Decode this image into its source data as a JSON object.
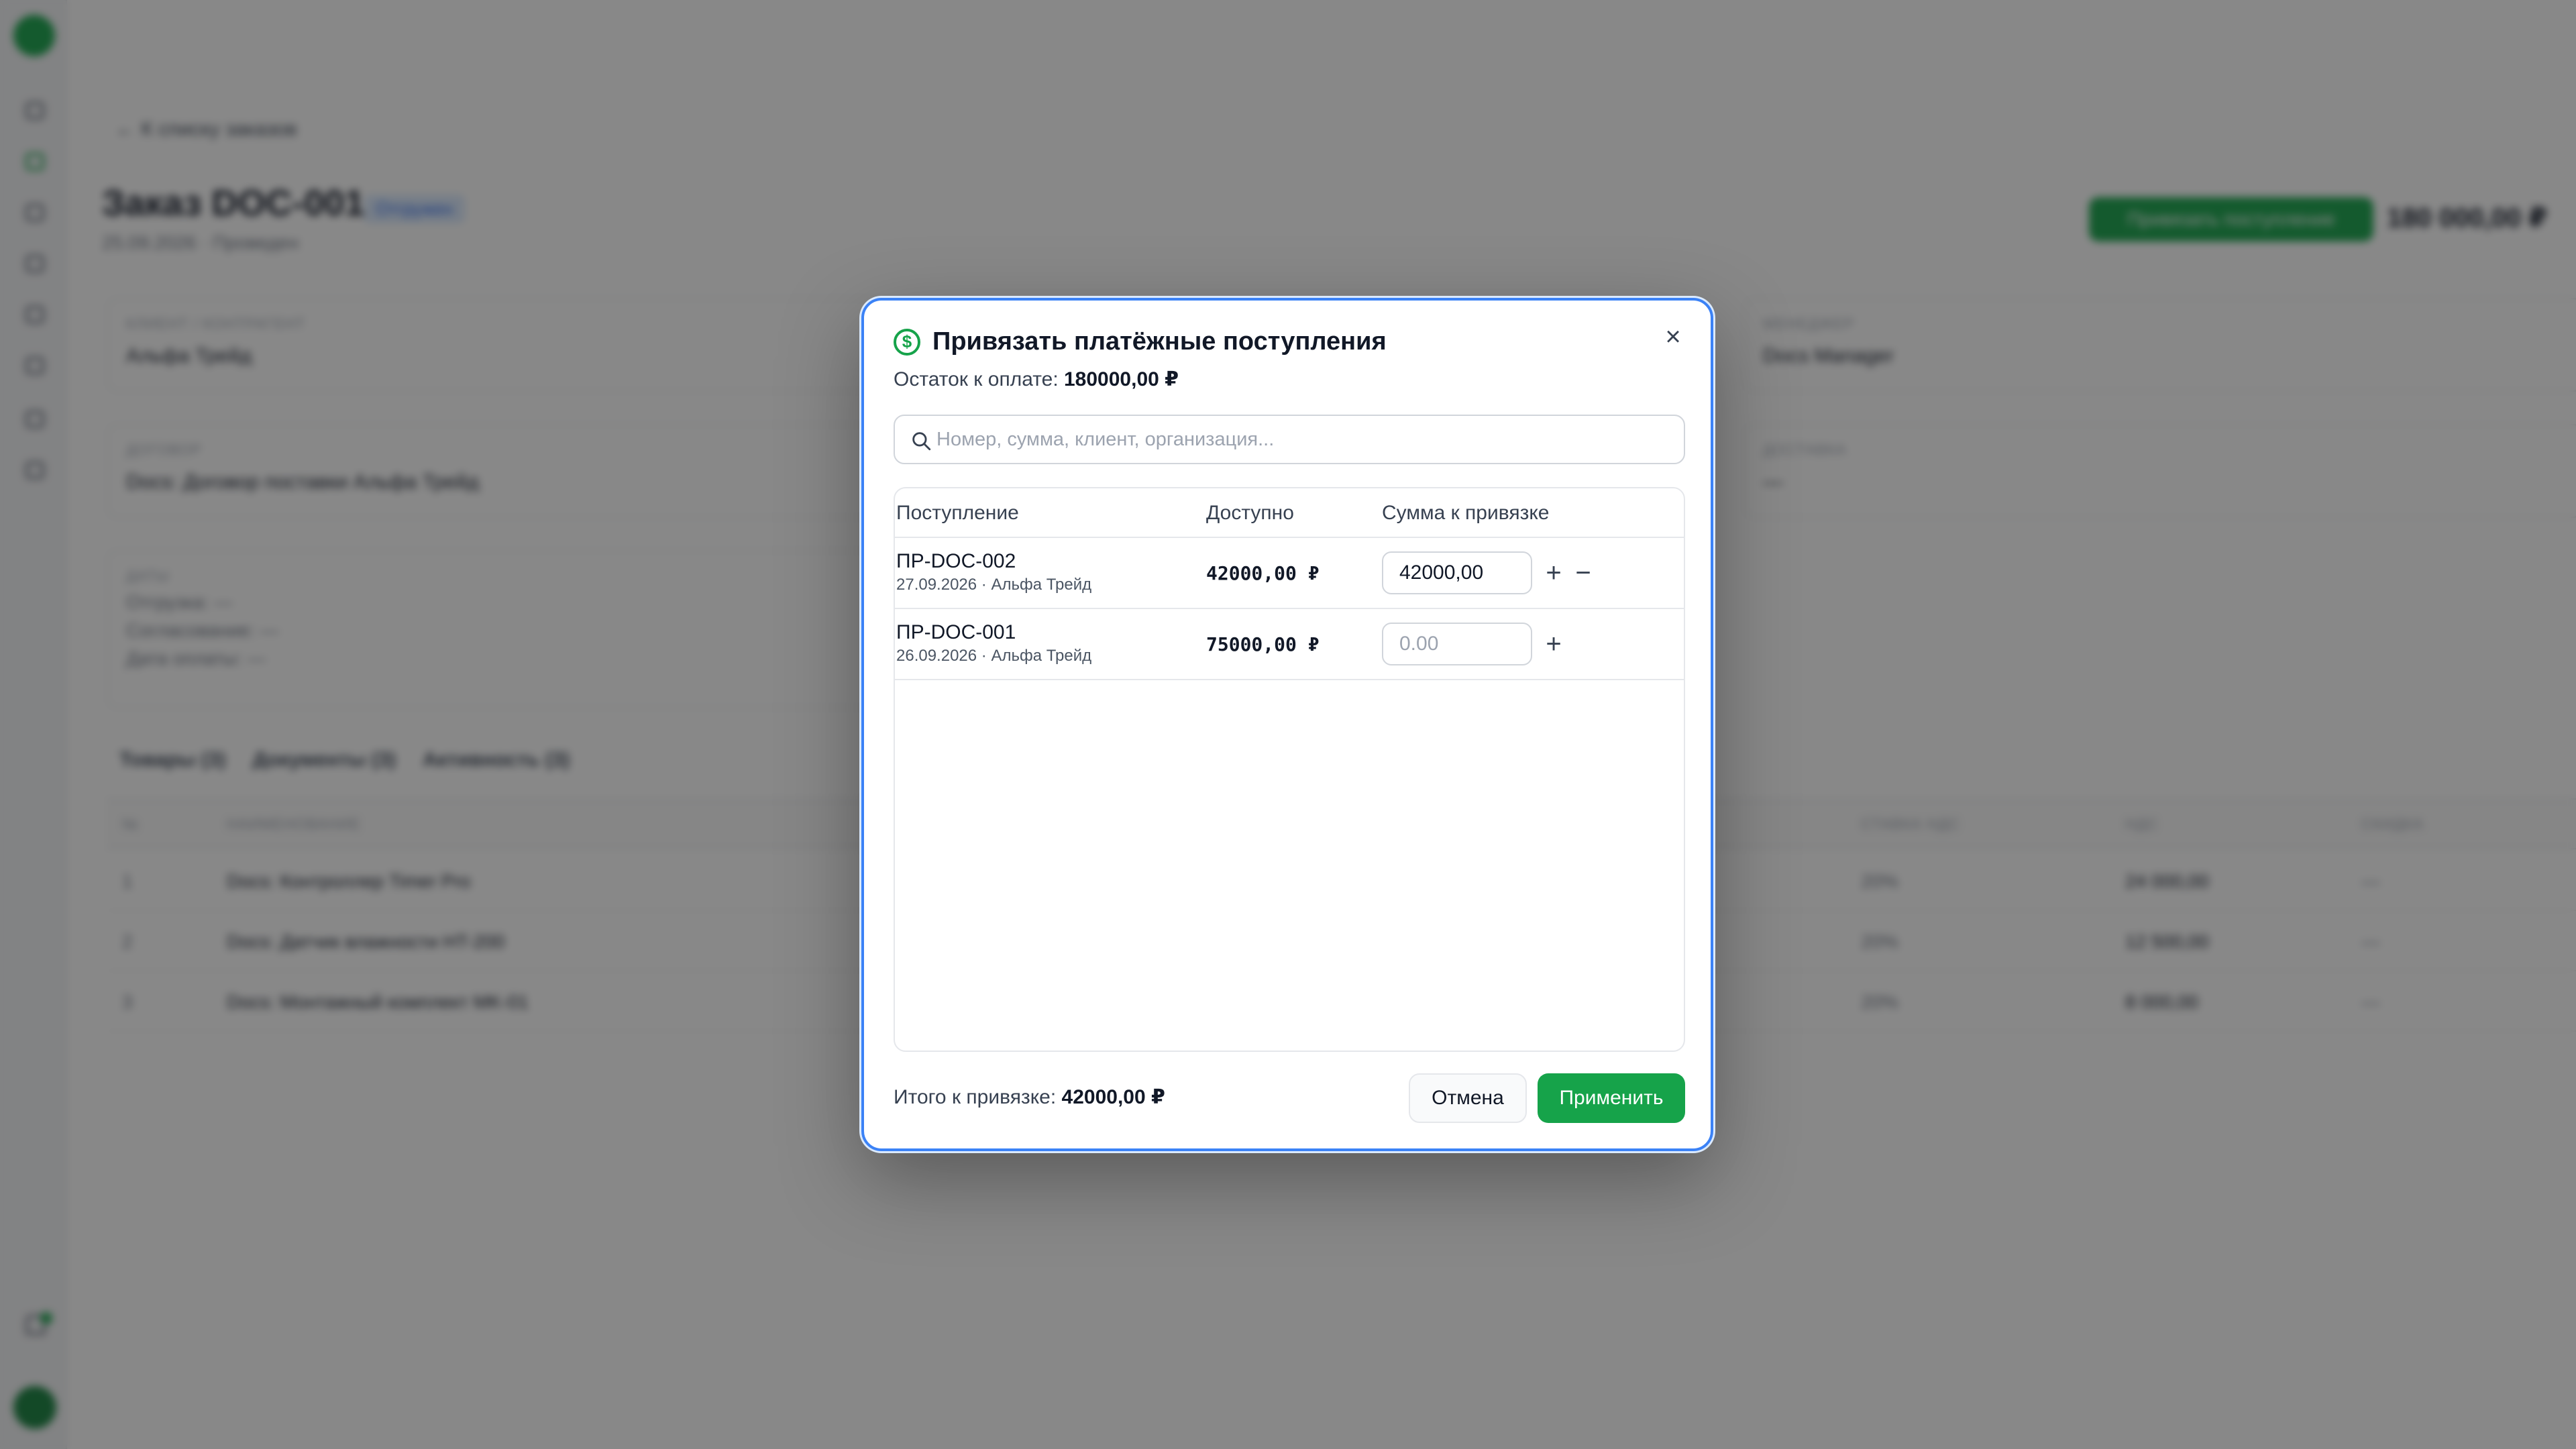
{
  "background": {
    "sidebar": {
      "items": [
        "dashboard",
        "orders",
        "clients",
        "products",
        "payments",
        "reports",
        "settings",
        "catalog"
      ]
    },
    "back_link": "← К списку заказов",
    "order": {
      "title": "Заказ DOC-001",
      "status_badge": "Отгружен",
      "subtitle": "25.09.2026 · Проведен",
      "attach_button": "Привязать поступление",
      "total": "180 000,00 ₽"
    },
    "cards": {
      "client_label": "КЛИЕНТ / КОНТРАГЕНТ",
      "client_value": "Альфа Трейд",
      "manager_label": "МЕНЕДЖЕР",
      "manager_value": "Docs Manager",
      "contract_label": "ДОГОВОР",
      "contract_value": "Docs: Договор поставки Альфа Трейд",
      "delivery_label": "ДОСТАВКА",
      "delivery_value": "—",
      "dates_label": "ДАТЫ",
      "dates_lines": [
        "Отгрузка: —",
        "Согласование: —",
        "Дата оплаты: —"
      ]
    },
    "tabs": [
      "Товары (3)",
      "Документы (3)",
      "Активность (3)"
    ],
    "table": {
      "headers": [
        "№",
        "НАИМЕНОВАНИЕ",
        "СТАВКА НДС",
        "НДС",
        "СКИДКА"
      ],
      "rows": [
        {
          "num": "1",
          "name": "Docs: Контроллер Timer Pro",
          "vat_rate": "20%",
          "vat": "24 000,00",
          "discount": "—"
        },
        {
          "num": "2",
          "name": "Docs: Датчик влажности HT-200",
          "vat_rate": "20%",
          "vat": "12 500,00",
          "discount": "—"
        },
        {
          "num": "3",
          "name": "Docs: Монтажный комплект MK-01",
          "vat_rate": "20%",
          "vat": "8 000,00",
          "discount": "—"
        }
      ]
    }
  },
  "modal": {
    "title": "Привязать платёжные поступления",
    "remaining_label": "Остаток к оплате:",
    "remaining_value": "180000,00 ₽",
    "search_placeholder": "Номер, сумма, клиент, организация...",
    "columns": {
      "receipt": "Поступление",
      "available": "Доступно",
      "amount": "Сумма к привязке"
    },
    "rows": [
      {
        "number": "ПР-DOC-002",
        "subtitle": "27.09.2026 · Альфа Трейд",
        "available": "42000,00 ₽",
        "amount_value": "42000,00",
        "amount_placeholder": "",
        "has_minus": true
      },
      {
        "number": "ПР-DOC-001",
        "subtitle": "26.09.2026 · Альфа Трейд",
        "available": "75000,00 ₽",
        "amount_value": "",
        "amount_placeholder": "0.00",
        "has_minus": false
      }
    ],
    "total_label": "Итого к привязке:",
    "total_value": "42000,00 ₽",
    "cancel_label": "Отмена",
    "apply_label": "Применить",
    "close_symbol": "×",
    "plus_symbol": "+",
    "minus_symbol": "−",
    "icon_symbol": "$",
    "accent_color": "#16a34a",
    "focus_color": "#3b82f6"
  }
}
